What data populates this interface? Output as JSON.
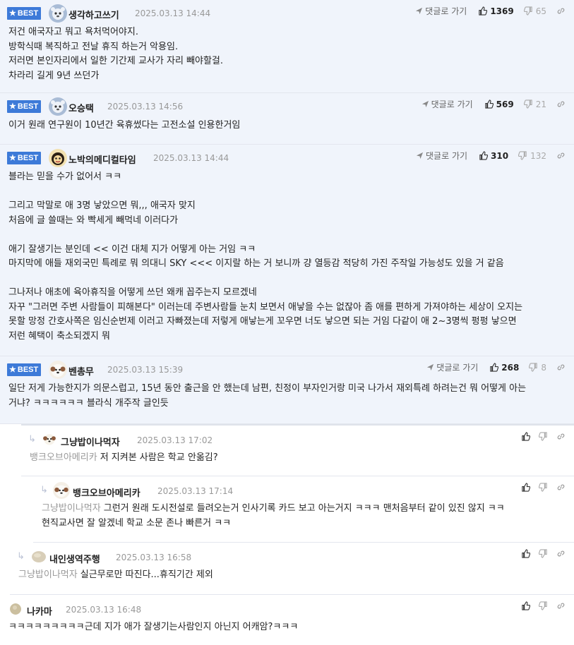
{
  "ui": {
    "reply_link": "댓글로 가기",
    "best_label": "BEST",
    "colors": {
      "best_bg": "#f0f4fb",
      "badge": "#3d7ad8",
      "mention": "#999999"
    }
  },
  "comments": [
    {
      "nick": "생각하고쓰기",
      "date": "2025.03.13 14:44",
      "likes": "1369",
      "dislikes": "65",
      "lines": [
        "저건 애국자고 뭐고 욕처먹어야지.",
        "방학식때 복직하고 전날 휴직 하는거 악용임.",
        "저러면 본인자리에서 일한 기간제 교사가 자리 빼야할걸.",
        "차라리 길게 9년 쓰던가"
      ]
    },
    {
      "nick": "오승택",
      "date": "2025.03.13 14:56",
      "likes": "569",
      "dislikes": "21",
      "lines": [
        "이거 원래 연구원이 10년간 육휴썼다는 고전소설 인용한거임"
      ]
    },
    {
      "nick": "노박의메디컬타임",
      "date": "2025.03.13 14:44",
      "likes": "310",
      "dislikes": "132",
      "lines": [
        "블라는 믿을 수가 없어서 ㅋㅋ",
        "",
        "그리고 막말로 애 3명 낳았으면 뭐,,, 애국자 맞지",
        "처음에 글 쓸때는 와 빡세게 빼먹네 이러다가",
        "",
        "애기 잘생기는 분인데 << 이건 대체 지가 어떻게 아는 거임 ㅋㅋ",
        "마지막에 애들 재외국민 특례로 뭐 의대니 SKY <<< 이지랄 하는 거 보니까 걍 열등감 적당히 가진 주작일 가능성도 있을 거 같음",
        "",
        "그나저나 애초에 육아휴직을 어떻게 쓰던 왜캐 꼽주는지 모르겠네",
        "자꾸 \"그러면 주변 사람들이 피해본다\" 이러는데 주변사람들 눈치 보면서 애낳을 수는 없잖아 좀 애를 편하게 가져야하는 세상이 오지는",
        "못할 망정 간호사쪽은 임신순번제 이러고 자빠졌는데 저렇게 애낳는게 꼬우면 너도 낳으면 되는 거임 다같이 애 2~3명씩 펑펑 낳으면",
        "저런 혜택이 축소되겠지 뭐"
      ]
    },
    {
      "nick": "벤총무",
      "date": "2025.03.13 15:39",
      "likes": "268",
      "dislikes": "8",
      "lines": [
        "일단 저게 가능한지가 의문스럽고, 15년 동안 출근을 안 했는데 남편, 친정이 부자인거랑 미국 나가서 재외특례 하려는건 뭐 어떻게 아는",
        "거냐? ㅋㅋㅋㅋㅋㅋ 블라식 개주작 글인듯"
      ]
    }
  ],
  "replies": [
    {
      "nick": "그냥밥이나먹자",
      "date": "2025.03.13 17:02",
      "mention": "뱅크오브아메리카",
      "lines": [
        "저 지켜본 사람은 학교 안옮김?"
      ]
    },
    {
      "nick": "뱅크오브아메리카",
      "date": "2025.03.13 17:14",
      "mention": "그냥밥이나먹자",
      "lines": [
        "그런거 원래 도시전설로 들려오는거 인사기록 카드 보고 아는거지 ㅋㅋㅋ 맨처음부터 같이 있진 않지 ㅋㅋ",
        "현직교사면 잘 알겠네 학교 소문 존나 빠른거 ㅋㅋ"
      ]
    },
    {
      "nick": "내인생역주행",
      "date": "2025.03.13 16:58",
      "mention": "그냥밥이나먹자",
      "lines": [
        "실근무로만 따진다...휴직기간 제외"
      ]
    },
    {
      "nick": "나카마",
      "date": "2025.03.13 16:48",
      "mention": "",
      "lines": [
        "ㅋㅋㅋㅋㅋㅋㅋㅋㅋ근데 지가 애가 잘생기는사람인지 아닌지 어캐암?ㅋㅋㅋ"
      ]
    }
  ]
}
